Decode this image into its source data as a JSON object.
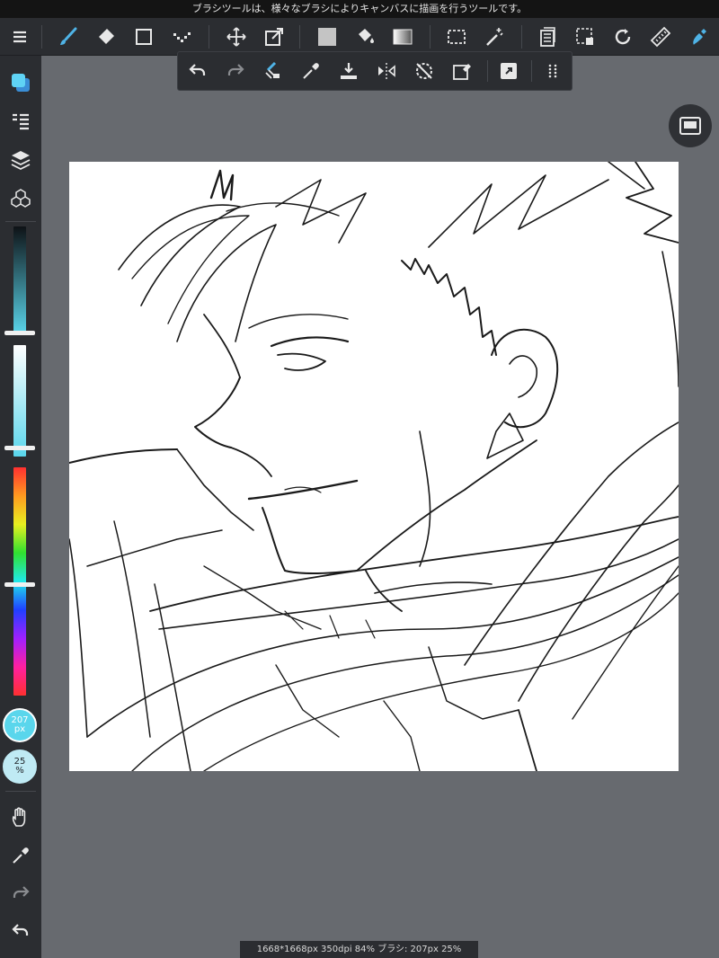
{
  "top_message": "ブラシツールは、様々なブラシによりキャンバスに描画を行うツールです。",
  "status_bar": "1668*1668px 350dpi 84% ブラシ: 207px 25%",
  "brush": {
    "size_value": "207",
    "size_unit": "px",
    "opacity_value": "25",
    "opacity_unit": "%"
  },
  "colors": {
    "accent": "#4fb3e6",
    "toolbar_bg": "#2b2d31",
    "workspace_bg": "#676a6f",
    "canvas_bg": "#ffffff"
  },
  "toolbar": {
    "tools": [
      "menu-icon",
      "brush-icon",
      "eraser-icon",
      "rectangle-icon",
      "dot-tool-icon",
      "move-icon",
      "transform-icon",
      "fill-color-icon",
      "bucket-icon",
      "gradient-icon",
      "select-icon",
      "magic-wand-icon",
      "layer-list-icon",
      "select-layer-icon",
      "rotate-icon",
      "ruler-icon",
      "brush-active-icon"
    ]
  },
  "subbar": {
    "tools": [
      "undo-icon",
      "redo-icon",
      "clear-icon",
      "eyedropper-icon",
      "import-icon",
      "flip-icon",
      "reset-rotate-icon",
      "eraser-select-icon",
      "share-icon",
      "more-icon"
    ]
  },
  "sidebar": {
    "tools": [
      "color-swatch-icon",
      "layer-panel-icon",
      "layers-icon",
      "materials-icon",
      "hand-icon",
      "eyedropper-icon",
      "redo-icon",
      "undo-icon"
    ],
    "hue_level": 0.51,
    "brightness_level": 0.98,
    "saturation_level": 0.92
  }
}
